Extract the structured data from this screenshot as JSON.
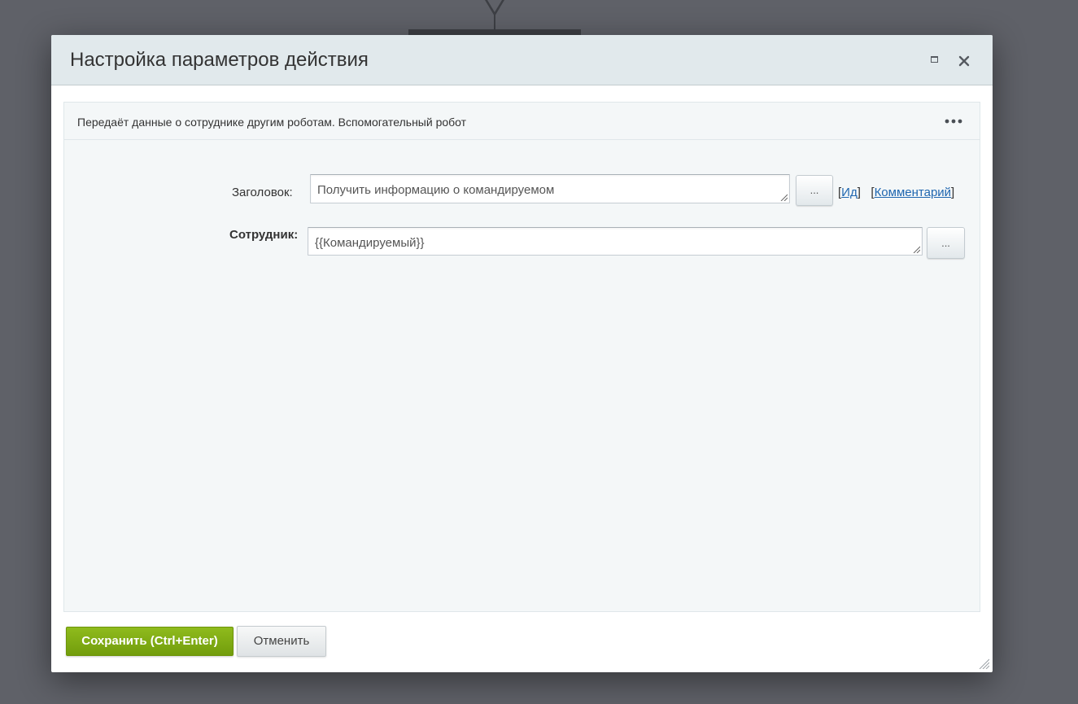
{
  "dialog": {
    "title": "Настройка параметров действия",
    "maximize_icon": "maximize-icon",
    "close_icon": "close-icon"
  },
  "panel": {
    "description": "Передаёт данные о сотруднике другим роботам. Вспомогательный робот",
    "more_icon": "more-horizontal-icon"
  },
  "fields": {
    "title": {
      "label": "Заголовок:",
      "value": "Получить информацию о командируемом",
      "dots_label": "...",
      "id_link": "Ид",
      "comment_link": "Комментарий"
    },
    "employee": {
      "label": "Сотрудник:",
      "value": "{{Командируемый}}",
      "dots_label": "..."
    }
  },
  "footer": {
    "save_label": "Сохранить (Ctrl+Enter)",
    "cancel_label": "Отменить"
  },
  "colors": {
    "save_button": "#7ba614",
    "link": "#2067b0",
    "header_bg": "#e1e9ec",
    "panel_bg": "#f4f7f8",
    "backdrop": "#5f6168"
  }
}
